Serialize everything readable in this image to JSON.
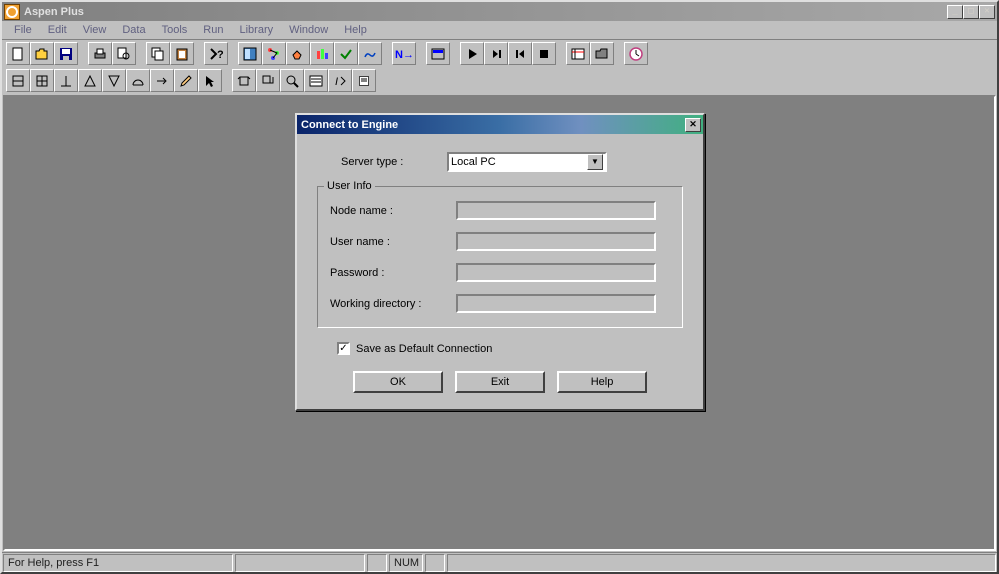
{
  "app": {
    "title": "Aspen Plus"
  },
  "menu": {
    "items": [
      "File",
      "Edit",
      "View",
      "Data",
      "Tools",
      "Run",
      "Library",
      "Window",
      "Help"
    ]
  },
  "dialog": {
    "title": "Connect to Engine",
    "server_type_label": "Server type :",
    "server_type_value": "Local PC",
    "user_info_legend": "User Info",
    "node_name_label": "Node name :",
    "node_name_value": "",
    "user_name_label": "User name :",
    "user_name_value": "",
    "password_label": "Password :",
    "password_value": "",
    "working_dir_label": "Working directory :",
    "working_dir_value": "",
    "save_default_label": "Save as Default Connection",
    "save_default_checked": "✓",
    "ok_label": "OK",
    "exit_label": "Exit",
    "help_label": "Help"
  },
  "status": {
    "help_text": "For Help, press F1",
    "num": "NUM"
  }
}
